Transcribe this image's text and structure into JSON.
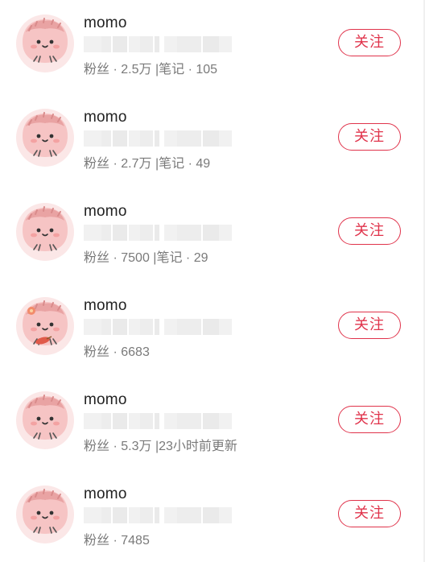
{
  "users": [
    {
      "name": "momo",
      "fans_label": "粉丝",
      "sep": "·",
      "fans": "2.5万",
      "divider": "|",
      "extra_label": "笔记",
      "extra_sep": "·",
      "extra_value": "105",
      "follow_label": "关注",
      "avatar_variant": "plain"
    },
    {
      "name": "momo",
      "fans_label": "粉丝",
      "sep": "·",
      "fans": "2.7万",
      "divider": "|",
      "extra_label": "笔记",
      "extra_sep": "·",
      "extra_value": "49",
      "follow_label": "关注",
      "avatar_variant": "plain"
    },
    {
      "name": "momo",
      "fans_label": "粉丝",
      "sep": "·",
      "fans": "7500",
      "divider": "|",
      "extra_label": "笔记",
      "extra_sep": "·",
      "extra_value": "29",
      "follow_label": "关注",
      "avatar_variant": "plain"
    },
    {
      "name": "momo",
      "fans_label": "粉丝",
      "sep": "·",
      "fans": "6683",
      "divider": "",
      "extra_label": "",
      "extra_sep": "",
      "extra_value": "",
      "follow_label": "关注",
      "avatar_variant": "flower"
    },
    {
      "name": "momo",
      "fans_label": "粉丝",
      "sep": "·",
      "fans": "5.3万",
      "divider": "|",
      "extra_label": "23小时前更新",
      "extra_sep": "",
      "extra_value": "",
      "follow_label": "关注",
      "avatar_variant": "plain"
    },
    {
      "name": "momo",
      "fans_label": "粉丝",
      "sep": "·",
      "fans": "7485",
      "divider": "",
      "extra_label": "",
      "extra_sep": "",
      "extra_value": "",
      "follow_label": "关注",
      "avatar_variant": "plain"
    }
  ],
  "colors": {
    "accent": "#e0334b",
    "avatar_bg": "#fbe3e3",
    "avatar_face": "#f7c6c6",
    "name": "#222222",
    "meta": "#7a7a7a",
    "blur": "#e6e6e6"
  },
  "icons": {
    "avatar": "pink-cartoon-avatar-icon"
  }
}
